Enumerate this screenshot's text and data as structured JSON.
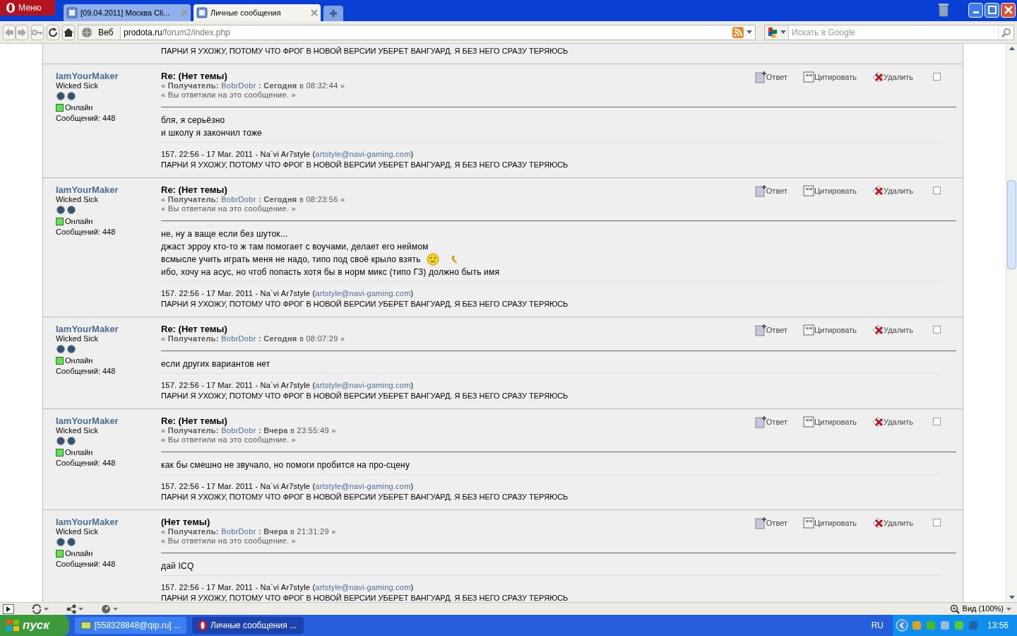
{
  "browser": {
    "menu_label": "Меню",
    "tabs": [
      {
        "title": "[09.04.2011] Москва Cli...",
        "selected": false
      },
      {
        "title": "Личные сообщения",
        "selected": true
      }
    ],
    "nav": {
      "search_engine_label": "Веб",
      "url_host": "prodota.ru",
      "url_path": "/forum2/index.php",
      "search_placeholder": "Искать в Google"
    }
  },
  "partial_signature": "ПАРНИ Я УХОЖУ, ПОТОМУ ЧТО ФРОГ В НОВОЙ ВЕРСИИ УБЕРЕТ ВАНГУАРД. Я БЕЗ НЕГО СРАЗУ ТЕРЯЮСЬ",
  "posts": [
    {
      "author": "IamYourMaker",
      "rank": "Wicked Sick",
      "online": true,
      "status": "Онлайн",
      "count": "Сообщений: 448",
      "subject": "Re: (Нет темы)",
      "meta_before": "« **Получатель:** ",
      "recipient": "BobrDobr",
      "meta_after": " **: Сегодня** в 08:32:44 »",
      "replied_note": "« Вы ответили на это сообщение. »",
      "actions": [
        "Ответ",
        "Цитировать",
        "Удалить"
      ],
      "checked": false,
      "body": [
        {
          "text": "бля, я серьёзно"
        },
        {
          "text": "и школу я закончил тоже"
        }
      ],
      "sig_before": "157. 22:56 - 17 Mar. 2011 - Na`vi Ar7style (",
      "sig_email": "artstyle@navi-gaming.com",
      "sig_after": ")",
      "sig_line2": "ПАРНИ Я УХОЖУ, ПОТОМУ ЧТО ФРОГ В НОВОЙ ВЕРСИИ УБЕРЕТ ВАНГУАРД. Я БЕЗ НЕГО СРАЗУ ТЕРЯЮСЬ"
    },
    {
      "author": "IamYourMaker",
      "rank": "Wicked Sick",
      "online": true,
      "status": "Онлайн",
      "count": "Сообщений: 448",
      "subject": "Re: (Нет темы)",
      "meta_before": "« **Получатель:** ",
      "recipient": "BobrDobr",
      "meta_after": " **: Сегодня** в 08:23:56 »",
      "replied_note": "« Вы ответили на это сообщение. »",
      "actions": [
        "Ответ",
        "Цитировать",
        "Удалить"
      ],
      "checked": false,
      "body": [
        {
          "text": "не, ну а ваще если без шуток..."
        },
        {
          "text": "джаст эрроу кто-то ж там помогает с воучами, делает его неймом"
        },
        {
          "text": "всмысле учить играть меня не надо, типо под своё крыло взять",
          "smileys": true
        },
        {
          "text": "ибо, хочу на асус, но чтоб попасть хотя бы в норм микс (типо ГЗ) должно быть имя"
        }
      ],
      "sig_before": "157. 22:56 - 17 Mar. 2011 - Na`vi Ar7style (",
      "sig_email": "artstyle@navi-gaming.com",
      "sig_after": ")",
      "sig_line2": "ПАРНИ Я УХОЖУ, ПОТОМУ ЧТО ФРОГ В НОВОЙ ВЕРСИИ УБЕРЕТ ВАНГУАРД. Я БЕЗ НЕГО СРАЗУ ТЕРЯЮСЬ"
    },
    {
      "author": "IamYourMaker",
      "rank": "Wicked Sick",
      "online": true,
      "status": "Онлайн",
      "count": "Сообщений: 448",
      "subject": "Re: (Нет темы)",
      "meta_before": "« **Получатель:** ",
      "recipient": "BobrDobr",
      "meta_after": " **: Сегодня** в 08:07:29 »",
      "actions": [
        "Ответ",
        "Цитировать",
        "Удалить"
      ],
      "checked": false,
      "body": [
        {
          "text": "если других вариантов нет"
        }
      ],
      "sig_before": "157. 22:56 - 17 Mar. 2011 - Na`vi Ar7style (",
      "sig_email": "artstyle@navi-gaming.com",
      "sig_after": ")",
      "sig_line2": "ПАРНИ Я УХОЖУ, ПОТОМУ ЧТО ФРОГ В НОВОЙ ВЕРСИИ УБЕРЕТ ВАНГУАРД. Я БЕЗ НЕГО СРАЗУ ТЕРЯЮСЬ"
    },
    {
      "author": "IamYourMaker",
      "rank": "Wicked Sick",
      "online": true,
      "status": "Онлайн",
      "count": "Сообщений: 448",
      "subject": "Re: (Нет темы)",
      "meta_before": "« **Получатель:** ",
      "recipient": "BobrDobr",
      "meta_after": " **: Вчера** в 23:55:49 »",
      "replied_note": "« Вы ответили на это сообщение. »",
      "actions": [
        "Ответ",
        "Цитировать",
        "Удалить"
      ],
      "checked": false,
      "body": [
        {
          "text": "как бы смешно не звучало, но помоги пробится на про-сцену"
        }
      ],
      "sig_before": "157. 22:56 - 17 Mar. 2011 - Na`vi Ar7style (",
      "sig_email": "artstyle@navi-gaming.com",
      "sig_after": ")",
      "sig_line2": "ПАРНИ Я УХОЖУ, ПОТОМУ ЧТО ФРОГ В НОВОЙ ВЕРСИИ УБЕРЕТ ВАНГУАРД. Я БЕЗ НЕГО СРАЗУ ТЕРЯЮСЬ"
    },
    {
      "author": "IamYourMaker",
      "rank": "Wicked Sick",
      "online": true,
      "status": "Онлайн",
      "count": "Сообщений: 448",
      "subject": "(Нет темы)",
      "meta_before": "« **Получатель:** ",
      "recipient": "BobrDobr",
      "meta_after": " **: Вчера** в 21:31:29 »",
      "replied_note": "« Вы ответили на это сообщение. »",
      "actions": [
        "Ответ",
        "Цитировать",
        "Удалить"
      ],
      "checked": false,
      "body": [
        {
          "text": "дай ICQ"
        }
      ],
      "sig_before": "157. 22:56 - 17 Mar. 2011 - Na`vi Ar7style (",
      "sig_email": "artstyle@navi-gaming.com",
      "sig_after": ")",
      "sig_line2": "ПАРНИ Я УХОЖУ, ПОТОМУ ЧТО ФРОГ В НОВОЙ ВЕРСИИ УБЕРЕТ ВАНГУАРД. Я БЕЗ НЕГО СРАЗУ ТЕРЯЮСЬ"
    }
  ],
  "status_bar": {
    "zoom": "Вид (100%)"
  },
  "taskbar": {
    "start": "пуск",
    "items": [
      {
        "title": "[558328848@qip.ru] ...",
        "selected": false
      },
      {
        "title": "Личные сообщения ...",
        "selected": true
      }
    ],
    "language": "RU",
    "clock": "13:56"
  }
}
